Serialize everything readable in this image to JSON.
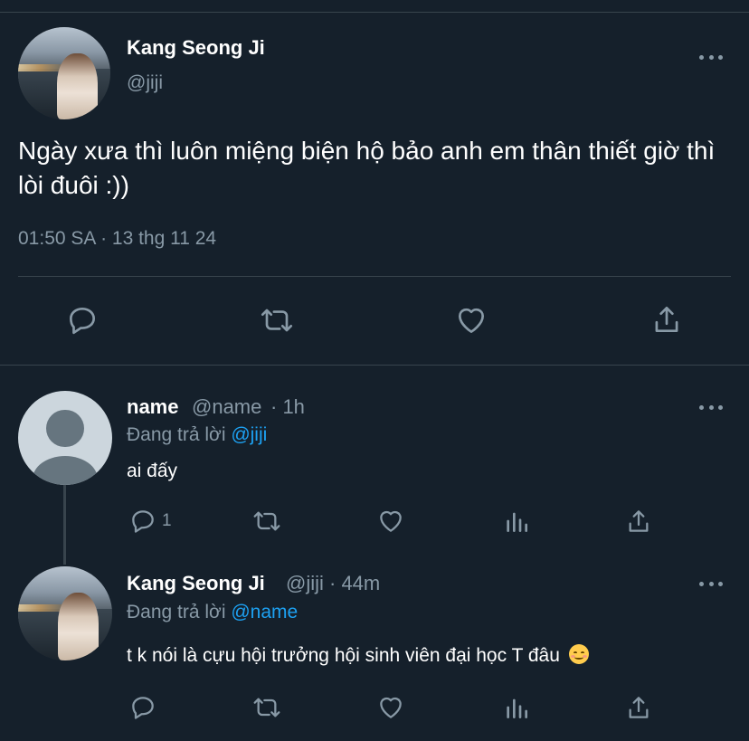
{
  "main_tweet": {
    "author_name": "Kang Seong Ji",
    "author_handle": "@jiji",
    "avatar": "user-photo-avatar",
    "text": "Ngày xưa thì luôn miệng biện hộ bảo anh em thân thiết giờ thì lòi đuôi :))",
    "timestamp": "01:50 SA · 13 thg 11 24",
    "actions": [
      "reply-icon",
      "retweet-icon",
      "like-icon",
      "share-icon"
    ]
  },
  "replies": [
    {
      "author_name": "name",
      "author_handle": "@name",
      "time": "· 1h",
      "replying_label": "Đang trả lời",
      "replying_to": "@jiji",
      "text": "ai đấy",
      "reply_count": "1",
      "avatar": "default-avatar"
    },
    {
      "author_name": "Kang Seong Ji",
      "author_handle": "@jiji",
      "time": "· 44m",
      "replying_label": "Đang trả lời",
      "replying_to": "@name",
      "text": "t k nói là cựu hội trưởng hội sinh viên đại học T đâu",
      "emoji": "smiling-face-emoji",
      "reply_count": "",
      "avatar": "user-photo-avatar"
    }
  ],
  "colors": {
    "background": "#15202b",
    "divider": "#38444d",
    "secondary_text": "#8899a6",
    "accent": "#1da1f2"
  }
}
